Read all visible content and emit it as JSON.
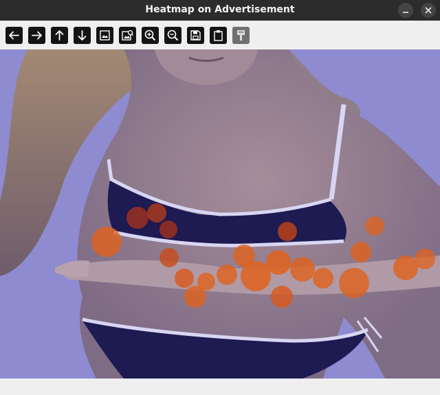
{
  "window": {
    "title": "Heatmap on Advertisement"
  },
  "toolbar": {
    "buttons": [
      {
        "icon": "arrow-left-icon",
        "action": "back"
      },
      {
        "icon": "arrow-right-icon",
        "action": "forward"
      },
      {
        "icon": "arrow-up-icon",
        "action": "up"
      },
      {
        "icon": "arrow-down-icon",
        "action": "down"
      },
      {
        "icon": "image-icon",
        "action": "image"
      },
      {
        "icon": "image-search-icon",
        "action": "image-search"
      },
      {
        "icon": "zoom-in-icon",
        "action": "zoom-in"
      },
      {
        "icon": "zoom-out-icon",
        "action": "zoom-out"
      },
      {
        "icon": "save-icon",
        "action": "save"
      },
      {
        "icon": "clipboard-icon",
        "action": "copy"
      },
      {
        "icon": "paint-brush-icon",
        "action": "paint",
        "enabled": false
      }
    ]
  },
  "colors": {
    "titlebar": "#2c2c2c",
    "toolbar": "#efefef",
    "overlay_tint": "#8a86cf",
    "heat_spot": "#e0621c",
    "heat_spot_dark": "#b8431a"
  }
}
